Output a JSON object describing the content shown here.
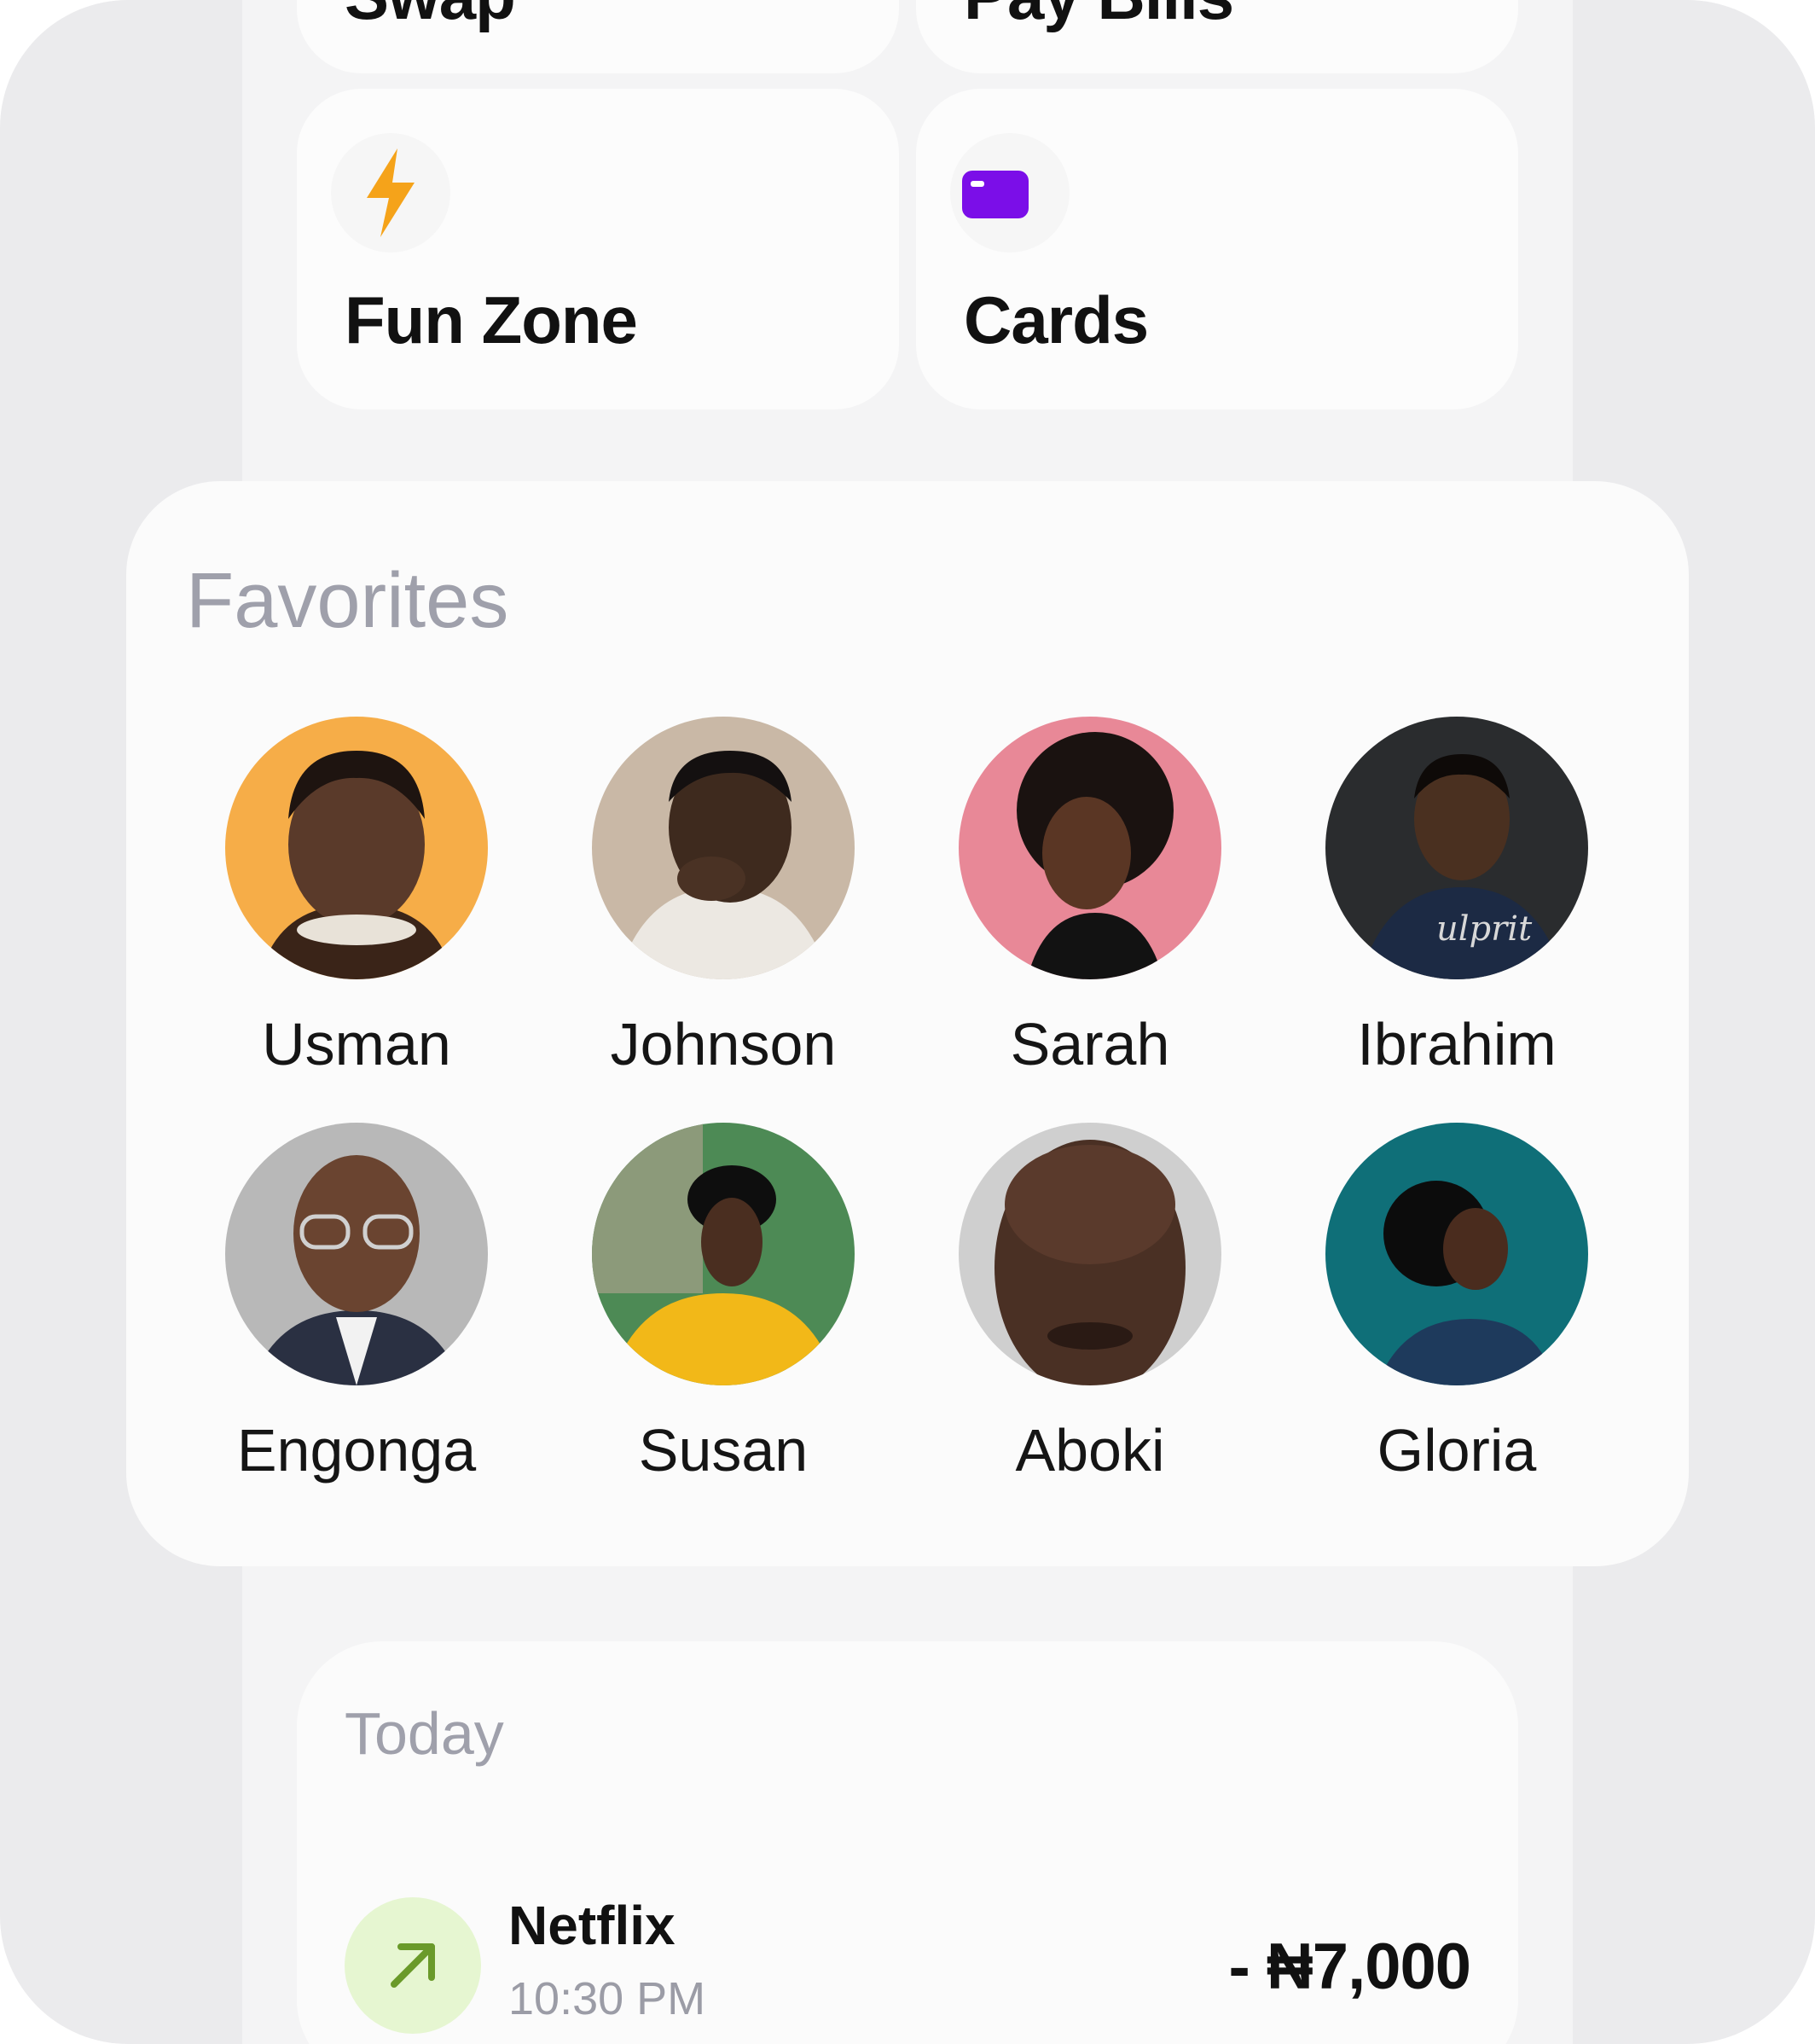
{
  "quick_actions": [
    {
      "label": "Swap",
      "icon": "swap-icon"
    },
    {
      "label": "Pay Bills",
      "icon": "bills-icon"
    },
    {
      "label": "Fun Zone",
      "icon": "lightning-icon",
      "icon_color": "#f5a31a"
    },
    {
      "label": "Cards",
      "icon": "card-icon",
      "icon_color": "#7b0ee8"
    }
  ],
  "favorites": {
    "title": "Favorites",
    "people": [
      {
        "name": "Usman",
        "bg": "#f6ad48"
      },
      {
        "name": "Johnson",
        "bg": "#c9b8a6"
      },
      {
        "name": "Sarah",
        "bg": "#e88897"
      },
      {
        "name": "Ibrahim",
        "bg": "#2a2c2e"
      },
      {
        "name": "Engonga",
        "bg": "#b8b8b8"
      },
      {
        "name": "Susan",
        "bg": "#4d8a55"
      },
      {
        "name": "Aboki",
        "bg": "#cfcfcf"
      },
      {
        "name": "Gloria",
        "bg": "#0f6f78"
      }
    ]
  },
  "today": {
    "title": "Today",
    "transactions": [
      {
        "name": "Netflix",
        "time": "10:30 PM",
        "amount": "- ₦7,000",
        "icon": "arrow-up-right-icon"
      }
    ]
  }
}
